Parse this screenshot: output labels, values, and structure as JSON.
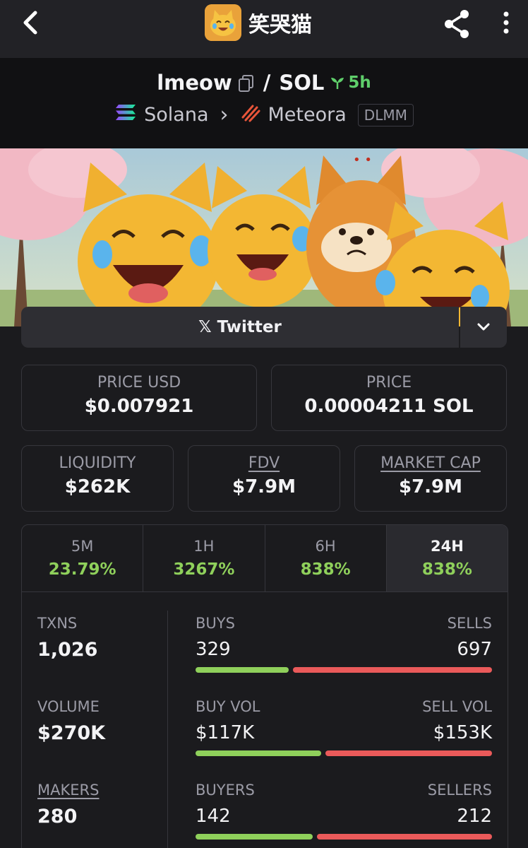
{
  "topbar": {
    "title": "笑哭猫"
  },
  "pair": {
    "base": "lmeow",
    "slash": "/",
    "quote": "SOL",
    "age": "5h",
    "chain": "Solana",
    "chevron": "›",
    "dex": "Meteora",
    "dex_type": "DLMM"
  },
  "social": {
    "twitter_label": "Twitter",
    "x_glyph": "𝕏"
  },
  "price": {
    "usd_label": "PRICE USD",
    "usd_value": "$0.007921",
    "native_label": "PRICE",
    "native_value": "0.00004211 SOL"
  },
  "metrics": {
    "liquidity_label": "LIQUIDITY",
    "liquidity_value": "$262K",
    "fdv_label": "FDV",
    "fdv_value": "$7.9M",
    "mcap_label": "MARKET CAP",
    "mcap_value": "$7.9M"
  },
  "timeframes": [
    {
      "label": "5M",
      "change": "23.79%"
    },
    {
      "label": "1H",
      "change": "3267%"
    },
    {
      "label": "6H",
      "change": "838%"
    },
    {
      "label": "24H",
      "change": "838%"
    }
  ],
  "stats": {
    "txns_label": "TXNS",
    "txns_value": "1,026",
    "buys_label": "BUYS",
    "buys_value": "329",
    "sells_label": "SELLS",
    "sells_value": "697",
    "buys_fraction": 0.32,
    "volume_label": "VOLUME",
    "volume_value": "$270K",
    "buy_vol_label": "BUY VOL",
    "buy_vol_value": "$117K",
    "sell_vol_label": "SELL VOL",
    "sell_vol_value": "$153K",
    "buy_vol_fraction": 0.43,
    "makers_label": "MAKERS",
    "makers_value": "280",
    "buyers_label": "BUYERS",
    "buyers_value": "142",
    "sellers_label": "SELLERS",
    "sellers_value": "212",
    "buyers_fraction": 0.4
  },
  "colors": {
    "positive": "#8fd05b",
    "negative": "#ea5a5a",
    "age": "#5fcf6b"
  }
}
